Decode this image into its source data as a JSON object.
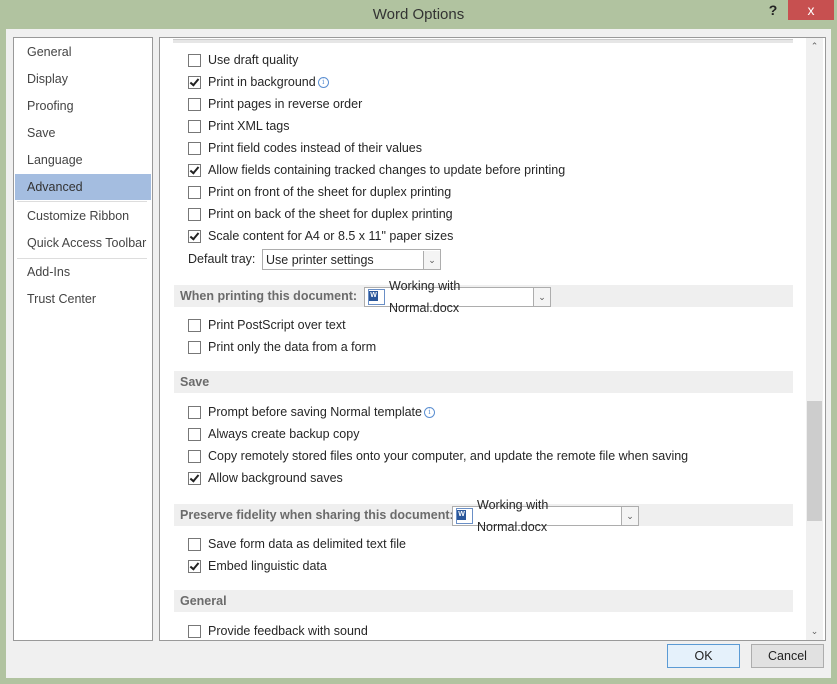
{
  "window": {
    "title": "Word Options",
    "help_label": "?",
    "close_label": "x"
  },
  "sidebar": {
    "items": [
      {
        "label": "General",
        "active": false
      },
      {
        "label": "Display",
        "active": false
      },
      {
        "label": "Proofing",
        "active": false
      },
      {
        "label": "Save",
        "active": false
      },
      {
        "label": "Language",
        "active": false
      },
      {
        "label": "Advanced",
        "active": true
      },
      {
        "label": "Customize Ribbon",
        "active": false
      },
      {
        "label": "Quick Access Toolbar",
        "active": false
      },
      {
        "label": "Add-Ins",
        "active": false
      },
      {
        "label": "Trust Center",
        "active": false
      }
    ]
  },
  "print_options": [
    {
      "label": "Use draft quality",
      "checked": false,
      "info": false
    },
    {
      "label": "Print in background",
      "checked": true,
      "info": true
    },
    {
      "label": "Print pages in reverse order",
      "checked": false,
      "info": false
    },
    {
      "label": "Print XML tags",
      "checked": false,
      "info": false
    },
    {
      "label": "Print field codes instead of their values",
      "checked": false,
      "info": false
    },
    {
      "label": "Allow fields containing tracked changes to update before printing",
      "checked": true,
      "info": false
    },
    {
      "label": "Print on front of the sheet for duplex printing",
      "checked": false,
      "info": false
    },
    {
      "label": "Print on back of the sheet for duplex printing",
      "checked": false,
      "info": false
    },
    {
      "label": "Scale content for A4 or 8.5 x 11\" paper sizes",
      "checked": true,
      "info": false
    }
  ],
  "default_tray": {
    "label": "Default tray:",
    "value": "Use printer settings"
  },
  "when_printing": {
    "heading": "When printing this document:",
    "document": "Working with Normal.docx",
    "options": [
      {
        "label": "Print PostScript over text",
        "checked": false
      },
      {
        "label": "Print only the data from a form",
        "checked": false
      }
    ]
  },
  "save": {
    "heading": "Save",
    "options": [
      {
        "label": "Prompt before saving Normal template",
        "checked": false,
        "info": true
      },
      {
        "label": "Always create backup copy",
        "checked": false
      },
      {
        "label": "Copy remotely stored files onto your computer, and update the remote file when saving",
        "checked": false
      },
      {
        "label": "Allow background saves",
        "checked": true
      }
    ]
  },
  "preserve_fidelity": {
    "heading": "Preserve fidelity when sharing this document:",
    "document": "Working with Normal.docx",
    "options": [
      {
        "label": "Save form data as delimited text file",
        "checked": false
      },
      {
        "label": "Embed linguistic data",
        "checked": true
      }
    ]
  },
  "general": {
    "heading": "General",
    "options": [
      {
        "label": "Provide feedback with sound",
        "checked": false
      }
    ]
  },
  "buttons": {
    "ok": "OK",
    "cancel": "Cancel"
  },
  "scrollbar": {
    "position_fraction": 0.6
  }
}
